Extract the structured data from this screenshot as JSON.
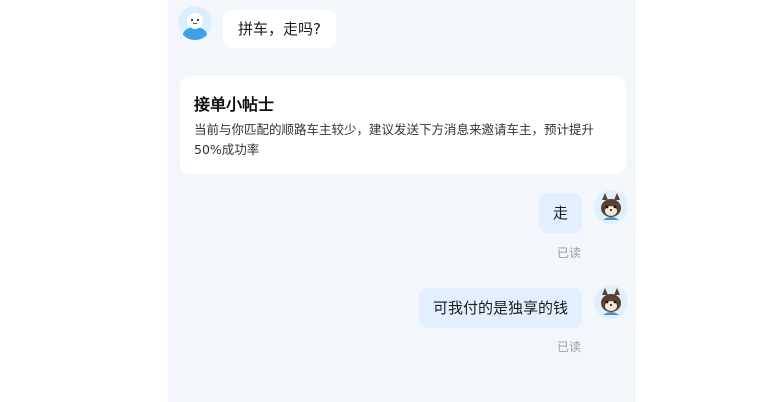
{
  "messages": {
    "incoming_1": "拼车，走吗?",
    "outgoing_1": "走",
    "outgoing_2": "可我付的是独享的钱"
  },
  "tips": {
    "title": "接单小帖士",
    "body": "当前与你匹配的顺路车主较少，建议发送下方消息来邀请车主，预计提升50%成功率"
  },
  "status": {
    "read_1": "已读",
    "read_2": "已读"
  },
  "icons": {
    "other_avatar": "blue-cartoon-avatar-icon",
    "self_avatar": "shiba-dog-avatar-icon"
  },
  "colors": {
    "chat_background": "#f3f6fa",
    "outgoing_bubble": "#e3efff",
    "incoming_bubble": "#ffffff",
    "read_status": "#9aa0a6"
  }
}
